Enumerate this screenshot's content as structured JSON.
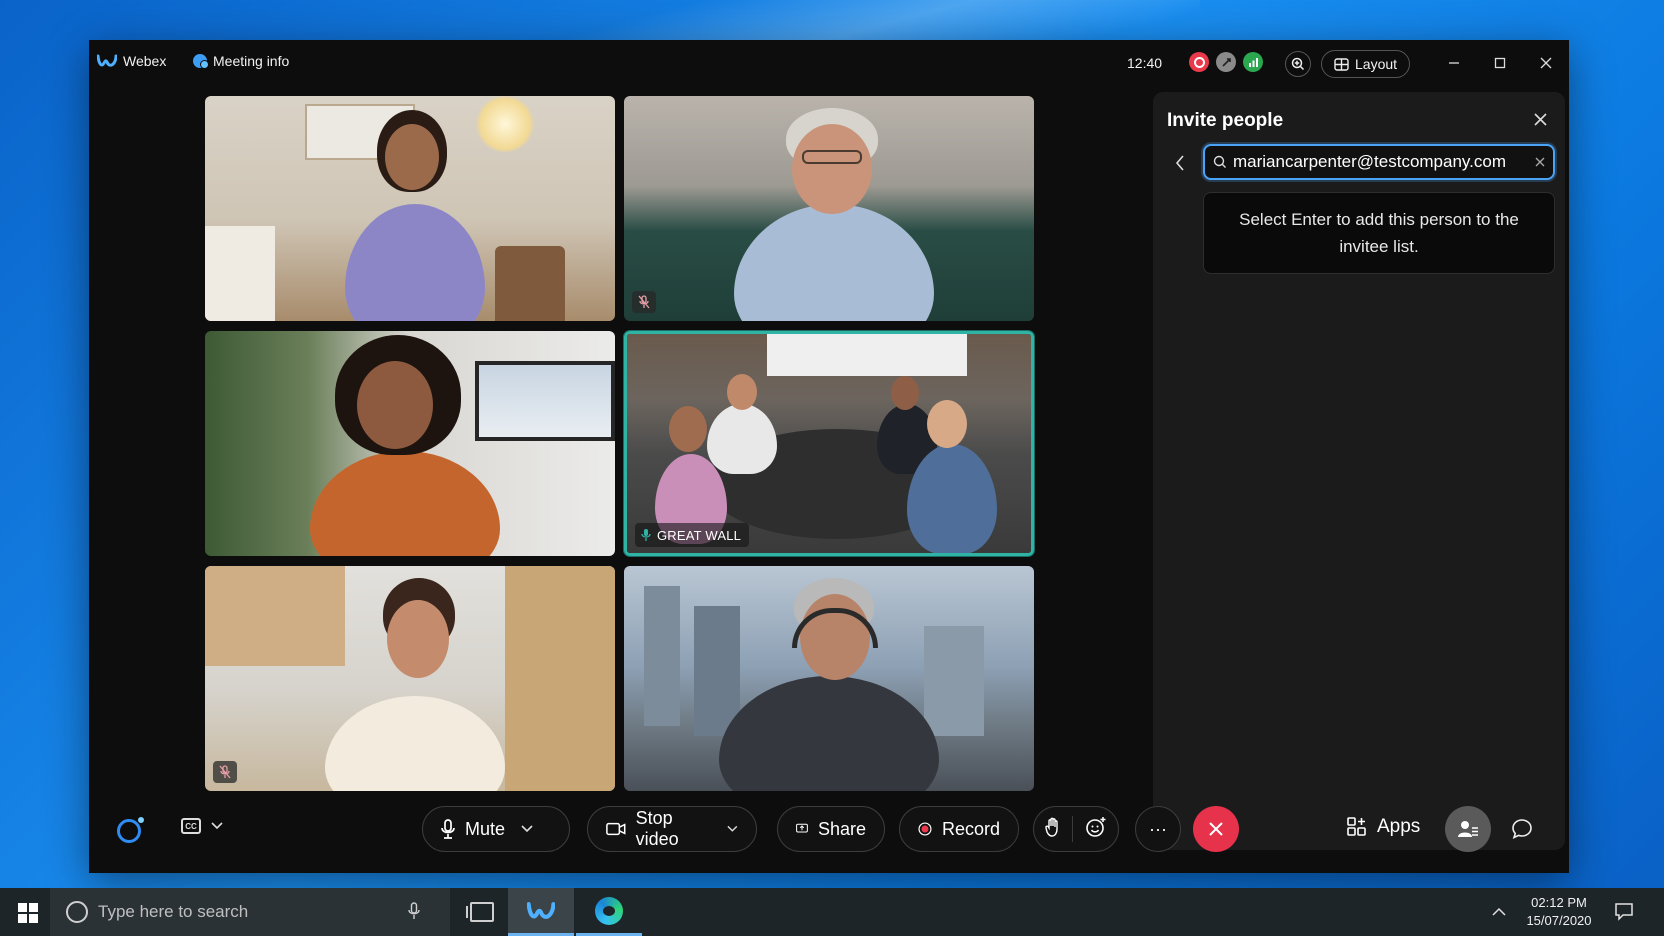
{
  "window": {
    "brand": "Webex",
    "meeting_info": "Meeting info",
    "time": "12:40",
    "layout_label": "Layout"
  },
  "tiles": [
    {
      "name": "",
      "muted": false,
      "active": false
    },
    {
      "name": "",
      "muted": true,
      "active": false
    },
    {
      "name": "",
      "muted": false,
      "active": false
    },
    {
      "name": "GREAT WALL",
      "muted": false,
      "active": true
    },
    {
      "name": "",
      "muted": true,
      "active": false
    },
    {
      "name": "",
      "muted": false,
      "active": false
    }
  ],
  "invite_panel": {
    "title": "Invite people",
    "search_value": "mariancarpenter@testcompany.com",
    "hint": "Select Enter to add this person to the invitee list."
  },
  "controls": {
    "mute": "Mute",
    "stop_video": "Stop video",
    "share": "Share",
    "record": "Record",
    "apps": "Apps",
    "more": "···"
  },
  "taskbar": {
    "search_placeholder": "Type here to search",
    "time": "02:12 PM",
    "date": "15/07/2020"
  },
  "colors": {
    "accent_blue": "#4aa3f5",
    "active_speaker": "#2fb3a5",
    "end_call": "#e6324b",
    "recording": "#e9394a"
  },
  "icons": {
    "brand": "webex-logo-icon",
    "zoom": "zoom-in-icon",
    "layout": "layout-grid-icon",
    "mic": "microphone-icon",
    "video": "video-camera-icon",
    "share": "share-screen-icon",
    "record": "record-icon",
    "raise_hand": "raise-hand-icon",
    "reactions": "emoji-icon",
    "end_call": "close-icon",
    "apps": "apps-icon",
    "participants": "participants-icon",
    "chat": "chat-bubble-icon"
  }
}
